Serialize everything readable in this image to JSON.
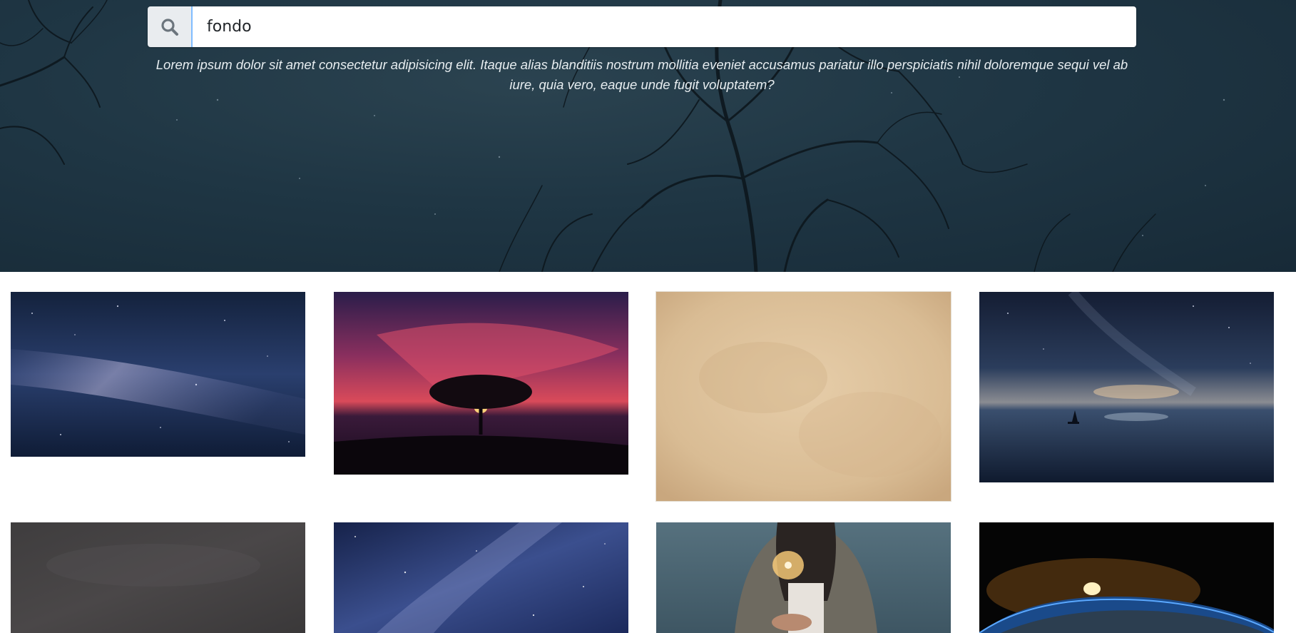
{
  "search": {
    "value": "fondo",
    "icon": "search-icon"
  },
  "hero": {
    "description": "Lorem ipsum dolor sit amet consectetur adipisicing elit. Itaque alias blanditiis nostrum mollitia eveniet accusamus pariatur illo perspiciatis nihil doloremque sequi vel ab iure, quia vero, eaque unde fugit voluptatem?"
  },
  "gallery": {
    "images": [
      {
        "name": "milky-way-image"
      },
      {
        "name": "tree-sunset-image"
      },
      {
        "name": "parchment-texture-image"
      },
      {
        "name": "sailboat-night-sky-image"
      },
      {
        "name": "chalkboard-texture-image"
      },
      {
        "name": "starry-sky-image"
      },
      {
        "name": "sparkler-image"
      },
      {
        "name": "earth-sunrise-image"
      }
    ]
  },
  "colors": {
    "hero_bg": "#1f3644",
    "addon_bg": "#e9ecef",
    "focus_border": "#80bdff",
    "hero_text": "#e7edf0"
  }
}
